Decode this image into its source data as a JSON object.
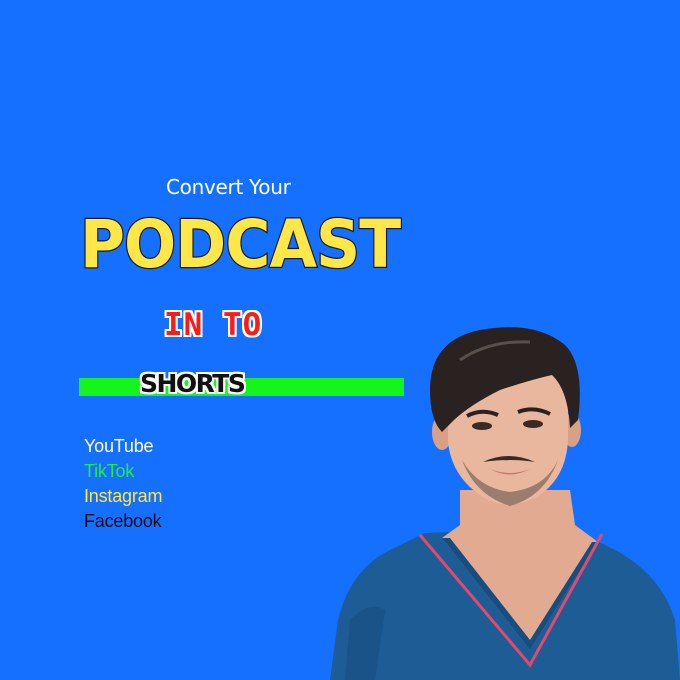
{
  "banner": {
    "subtitle": "Convert Your",
    "headline": "PODCAST",
    "connector": "IN TO",
    "highlight": "SHORTS"
  },
  "platforms": [
    {
      "label": "YouTube",
      "color": "#FFFFFF"
    },
    {
      "label": "TikTok",
      "color": "#1EF03A"
    },
    {
      "label": "Instagram",
      "color": "#FFE74A"
    },
    {
      "label": "Facebook",
      "color": "#0D0D1A"
    }
  ],
  "colors": {
    "background": "#1570FF",
    "headline": "#FFE74A",
    "connector": "#FF1A1A",
    "highlight_bar": "#14F51C",
    "shirt": "#1D5C94",
    "shirt_trim": "#E04A6E",
    "skin": "#E9B79E",
    "hair": "#2A2220"
  },
  "image": {
    "subject": "portrait-photo"
  }
}
